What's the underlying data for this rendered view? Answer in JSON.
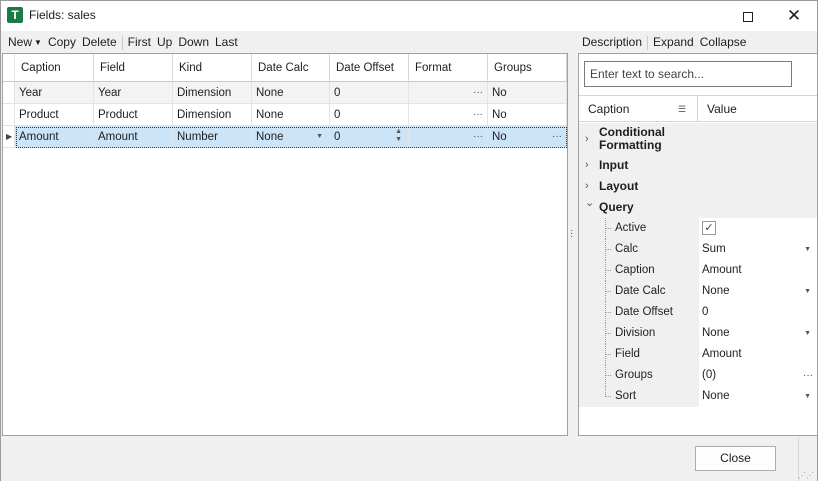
{
  "window": {
    "title": "Fields: sales",
    "app_icon_letter": "T",
    "max_icon": "maximize-icon",
    "close_glyph": "✕"
  },
  "toolbar_left": {
    "new": "New",
    "copy": "Copy",
    "delete": "Delete",
    "first": "First",
    "up": "Up",
    "down": "Down",
    "last": "Last"
  },
  "toolbar_right": {
    "description": "Description",
    "expand": "Expand",
    "collapse": "Collapse"
  },
  "grid": {
    "columns": [
      "Caption",
      "Field",
      "Kind",
      "Date Calc",
      "Date Offset",
      "Format",
      "Groups"
    ],
    "rows": [
      [
        "Year",
        "Year",
        "Dimension",
        "None",
        "0",
        "",
        "No"
      ],
      [
        "Product",
        "Product",
        "Dimension",
        "None",
        "0",
        "",
        "No"
      ],
      [
        "Amount",
        "Amount",
        "Number",
        "None",
        "0",
        "",
        "No"
      ]
    ],
    "selected_row": 2
  },
  "properties": {
    "search_placeholder": "Enter text to search...",
    "header_caption": "Caption",
    "header_value": "Value",
    "categories": [
      {
        "label": "Conditional",
        "label2": "Formatting",
        "expanded": false
      },
      {
        "label": "Input",
        "expanded": false
      },
      {
        "label": "Layout",
        "expanded": false
      },
      {
        "label": "Query",
        "expanded": true
      }
    ],
    "query_items": [
      {
        "name": "Active",
        "value": "",
        "editor": "checkbox",
        "checked": true
      },
      {
        "name": "Calc",
        "value": "Sum",
        "editor": "dropdown"
      },
      {
        "name": "Caption",
        "value": "Amount",
        "editor": "text"
      },
      {
        "name": "Date Calc",
        "value": "None",
        "editor": "dropdown"
      },
      {
        "name": "Date Offset",
        "value": "0",
        "editor": "spin"
      },
      {
        "name": "Division",
        "value": "None",
        "editor": "dropdown"
      },
      {
        "name": "Field",
        "value": "Amount",
        "editor": "text"
      },
      {
        "name": "Groups",
        "value": "(0)",
        "editor": "ellipsis"
      },
      {
        "name": "Sort",
        "value": "None",
        "editor": "dropdown"
      }
    ]
  },
  "footer": {
    "close_label": "Close"
  },
  "colors": {
    "selection": "#cce4f7",
    "app_icon": "#1e7a44"
  }
}
